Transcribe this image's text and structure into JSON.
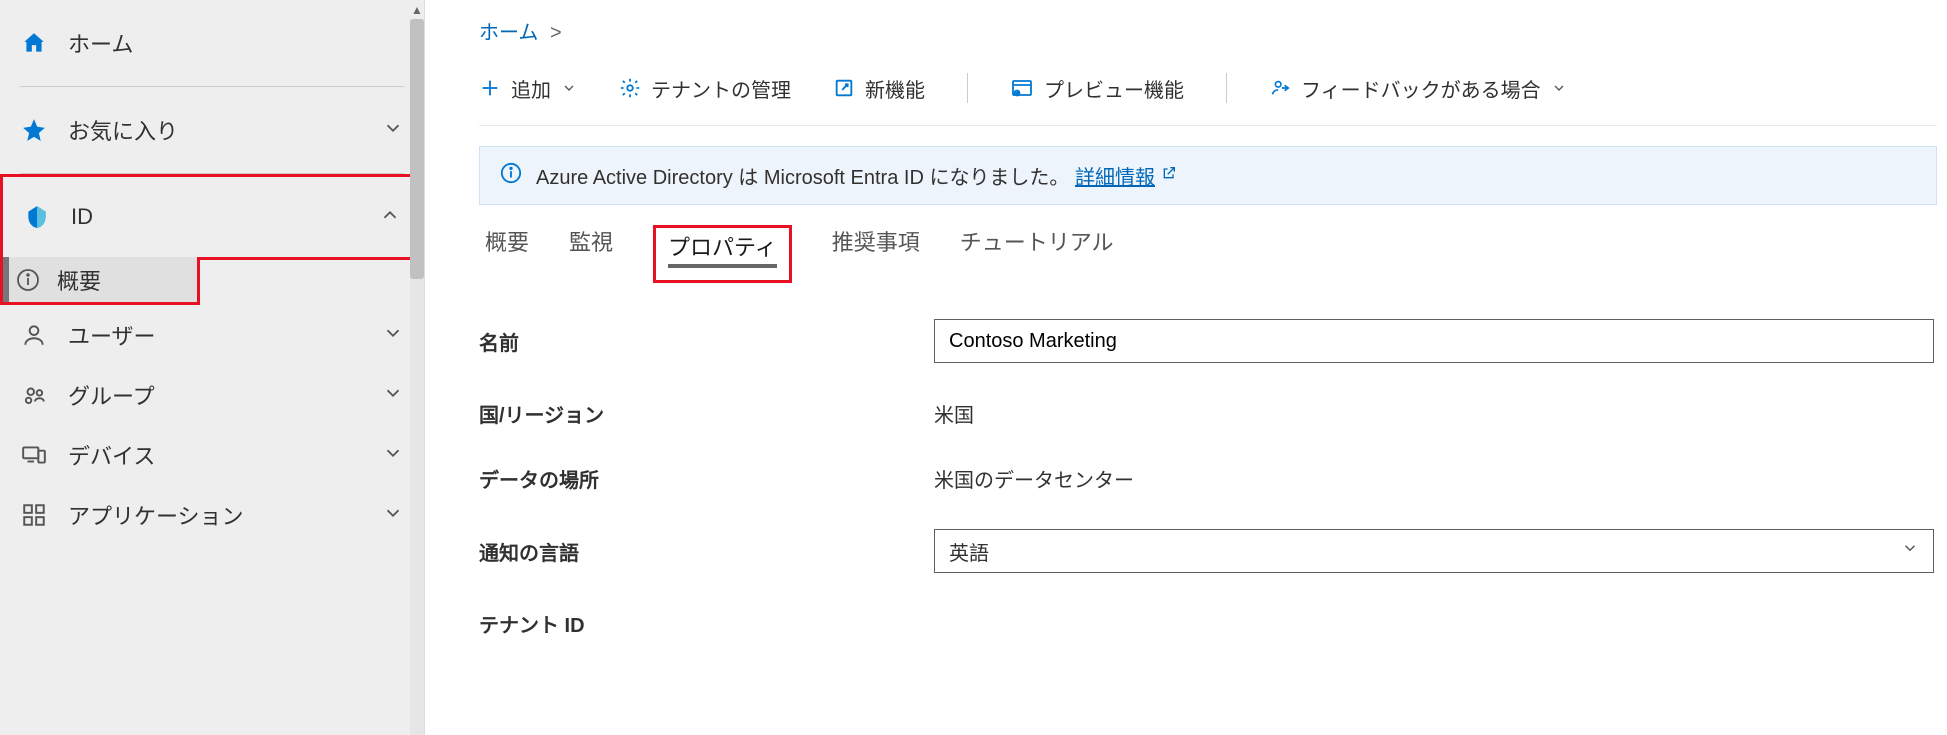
{
  "sidebar": {
    "home": "ホーム",
    "favorites": "お気に入り",
    "id_section": "ID",
    "overview": "概要",
    "users": "ユーザー",
    "groups": "グループ",
    "devices": "デバイス",
    "applications": "アプリケーション"
  },
  "breadcrumb": {
    "home": "ホーム",
    "sep": ">"
  },
  "toolbar": {
    "add": "追加",
    "manage_tenant": "テナントの管理",
    "whats_new": "新機能",
    "preview": "プレビュー機能",
    "feedback": "フィードバックがある場合"
  },
  "banner": {
    "text": "Azure Active Directory は Microsoft Entra ID になりました。",
    "link": "詳細情報"
  },
  "tabs": {
    "overview": "概要",
    "monitoring": "監視",
    "properties": "プロパティ",
    "recommendations": "推奨事項",
    "tutorials": "チュートリアル"
  },
  "form": {
    "name_label": "名前",
    "name_value": "Contoso Marketing",
    "country_label": "国/リージョン",
    "country_value": "米国",
    "data_location_label": "データの場所",
    "data_location_value": "米国のデータセンター",
    "notification_lang_label": "通知の言語",
    "notification_lang_value": "英語",
    "tenant_id_label": "テナント ID"
  }
}
